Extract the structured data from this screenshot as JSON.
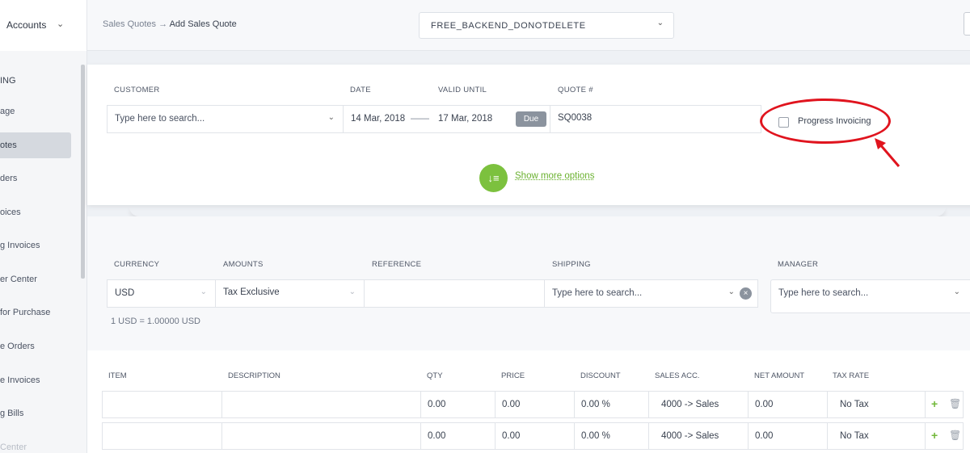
{
  "header": {
    "app_menu": "Accounts",
    "breadcrumb_parent": "Sales Quotes",
    "breadcrumb_arrow": "→",
    "breadcrumb_current": "Add Sales Quote",
    "organization": "FREE_BACKEND_DONOTDELETE"
  },
  "sidebar": {
    "items": [
      {
        "label": "ING"
      },
      {
        "label": "age"
      },
      {
        "label": "otes"
      },
      {
        "label": "ders"
      },
      {
        "label": "oices"
      },
      {
        "label": "g Invoices"
      },
      {
        "label": "er Center"
      },
      {
        "label": "for Purchase"
      },
      {
        "label": "e Orders"
      },
      {
        "label": "e Invoices"
      },
      {
        "label": "g Bills"
      },
      {
        "label": "Center"
      }
    ]
  },
  "quote": {
    "labels": {
      "customer": "CUSTOMER",
      "date": "DATE",
      "valid_until": "VALID UNTIL",
      "quote_no": "QUOTE #"
    },
    "customer_placeholder": "Type here to search...",
    "date": "14 Mar, 2018",
    "date_sep": "——",
    "valid_until": "17 Mar, 2018",
    "due_badge": "Due",
    "quote_no": "SQ0038",
    "progress_invoicing": "Progress Invoicing",
    "progress_invoicing_checked": false,
    "show_more": "Show more options"
  },
  "details": {
    "labels": {
      "currency": "CURRENCY",
      "amounts": "AMOUNTS",
      "reference": "REFERENCE",
      "shipping": "SHIPPING",
      "manager": "MANAGER"
    },
    "currency": "USD",
    "amounts": "Tax Exclusive",
    "reference": "",
    "shipping_placeholder": "Type here to search...",
    "manager_placeholder": "Type here to search...",
    "exchange_rate": "1 USD = 1.00000 USD"
  },
  "items": {
    "headers": [
      "ITEM",
      "DESCRIPTION",
      "QTY",
      "PRICE",
      "DISCOUNT",
      "SALES ACC.",
      "NET AMOUNT",
      "TAX RATE"
    ],
    "rows": [
      {
        "item": "",
        "description": "",
        "qty": "0.00",
        "price": "0.00",
        "discount": "0.00 %",
        "sales_acc": "4000 -> Sales",
        "net_amount": "0.00",
        "tax_rate": "No Tax"
      },
      {
        "item": "",
        "description": "",
        "qty": "0.00",
        "price": "0.00",
        "discount": "0.00 %",
        "sales_acc": "4000 -> Sales",
        "net_amount": "0.00",
        "tax_rate": "No Tax"
      }
    ]
  },
  "colors": {
    "accent_green": "#7cc13e",
    "annotation_red": "#e0141e",
    "due_badge": "#8b939e"
  }
}
